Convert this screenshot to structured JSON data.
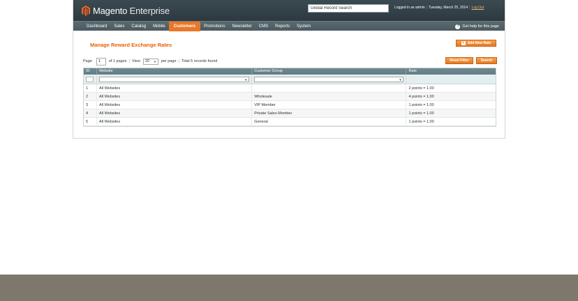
{
  "header": {
    "brand": "Magento",
    "brand_edition": "Enterprise",
    "global_search_value": "Global Record Search",
    "logged_in": "Logged in as admin",
    "date": "Tuesday, March 25, 2014",
    "logout": "Log Out"
  },
  "nav": {
    "items": [
      {
        "label": "Dashboard"
      },
      {
        "label": "Sales"
      },
      {
        "label": "Catalog"
      },
      {
        "label": "Mobile"
      },
      {
        "label": "Customers"
      },
      {
        "label": "Promotions"
      },
      {
        "label": "Newsletter"
      },
      {
        "label": "CMS"
      },
      {
        "label": "Reports"
      },
      {
        "label": "System"
      }
    ],
    "active": "Customers",
    "help": "Get help for this page"
  },
  "page": {
    "title": "Manage Reward Exchange Rates",
    "add_button": "Add New Rate",
    "reset_button": "Reset Filter",
    "search_button": "Search"
  },
  "pager": {
    "page_label": "Page",
    "page_value": "1",
    "of_pages": "of 1 pages",
    "view_label": "View",
    "view_value": "20",
    "per_page": "per page",
    "total": "Total 5 records found"
  },
  "grid": {
    "columns": {
      "id": "ID",
      "website": "Website",
      "group": "Customer Group",
      "rate": "Rate"
    },
    "rows": [
      {
        "id": "1",
        "website": "All Websites",
        "group": "",
        "rate": "2 points = 1.00"
      },
      {
        "id": "2",
        "website": "All Websites",
        "group": "Wholesale",
        "rate": "4 points = 1.00"
      },
      {
        "id": "3",
        "website": "All Websites",
        "group": "VIP Member",
        "rate": "1 points = 1.00"
      },
      {
        "id": "4",
        "website": "All Websites",
        "group": "Private Sales Member",
        "rate": "1 points = 1.00"
      },
      {
        "id": "5",
        "website": "All Websites",
        "group": "General",
        "rate": "1 points = 1.00"
      }
    ]
  },
  "colors": {
    "accent": "#e9772a",
    "title": "#eb5e00",
    "header_bg": "#2d393f",
    "footer_band": "#7e786c"
  }
}
